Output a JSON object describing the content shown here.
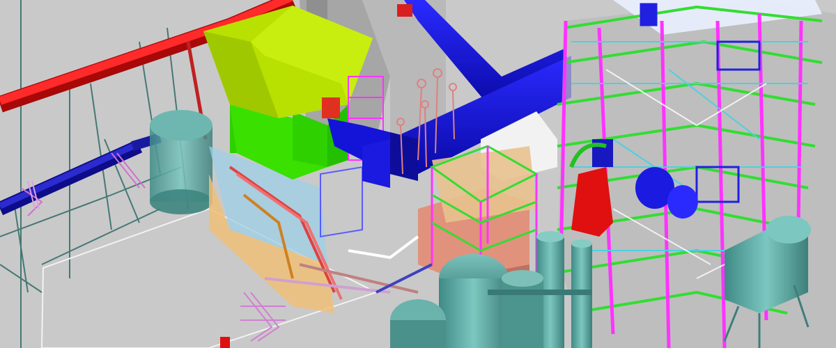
{
  "scene": {
    "subject": "plant-3d-model-render",
    "colors": {
      "background": "#c9c9c9",
      "pipe_red": "#e01010",
      "duct_blue": "#1010e0",
      "roof_green": "#b8e000",
      "wall_green": "#39e000",
      "structure_green": "#33dd33",
      "structure_magenta": "#ff33ff",
      "vessel_teal": "#5aa6a0",
      "block_salmon": "#e0927c",
      "slab_orange": "#f0c078",
      "concrete_gray": "#a8a8a8"
    }
  }
}
